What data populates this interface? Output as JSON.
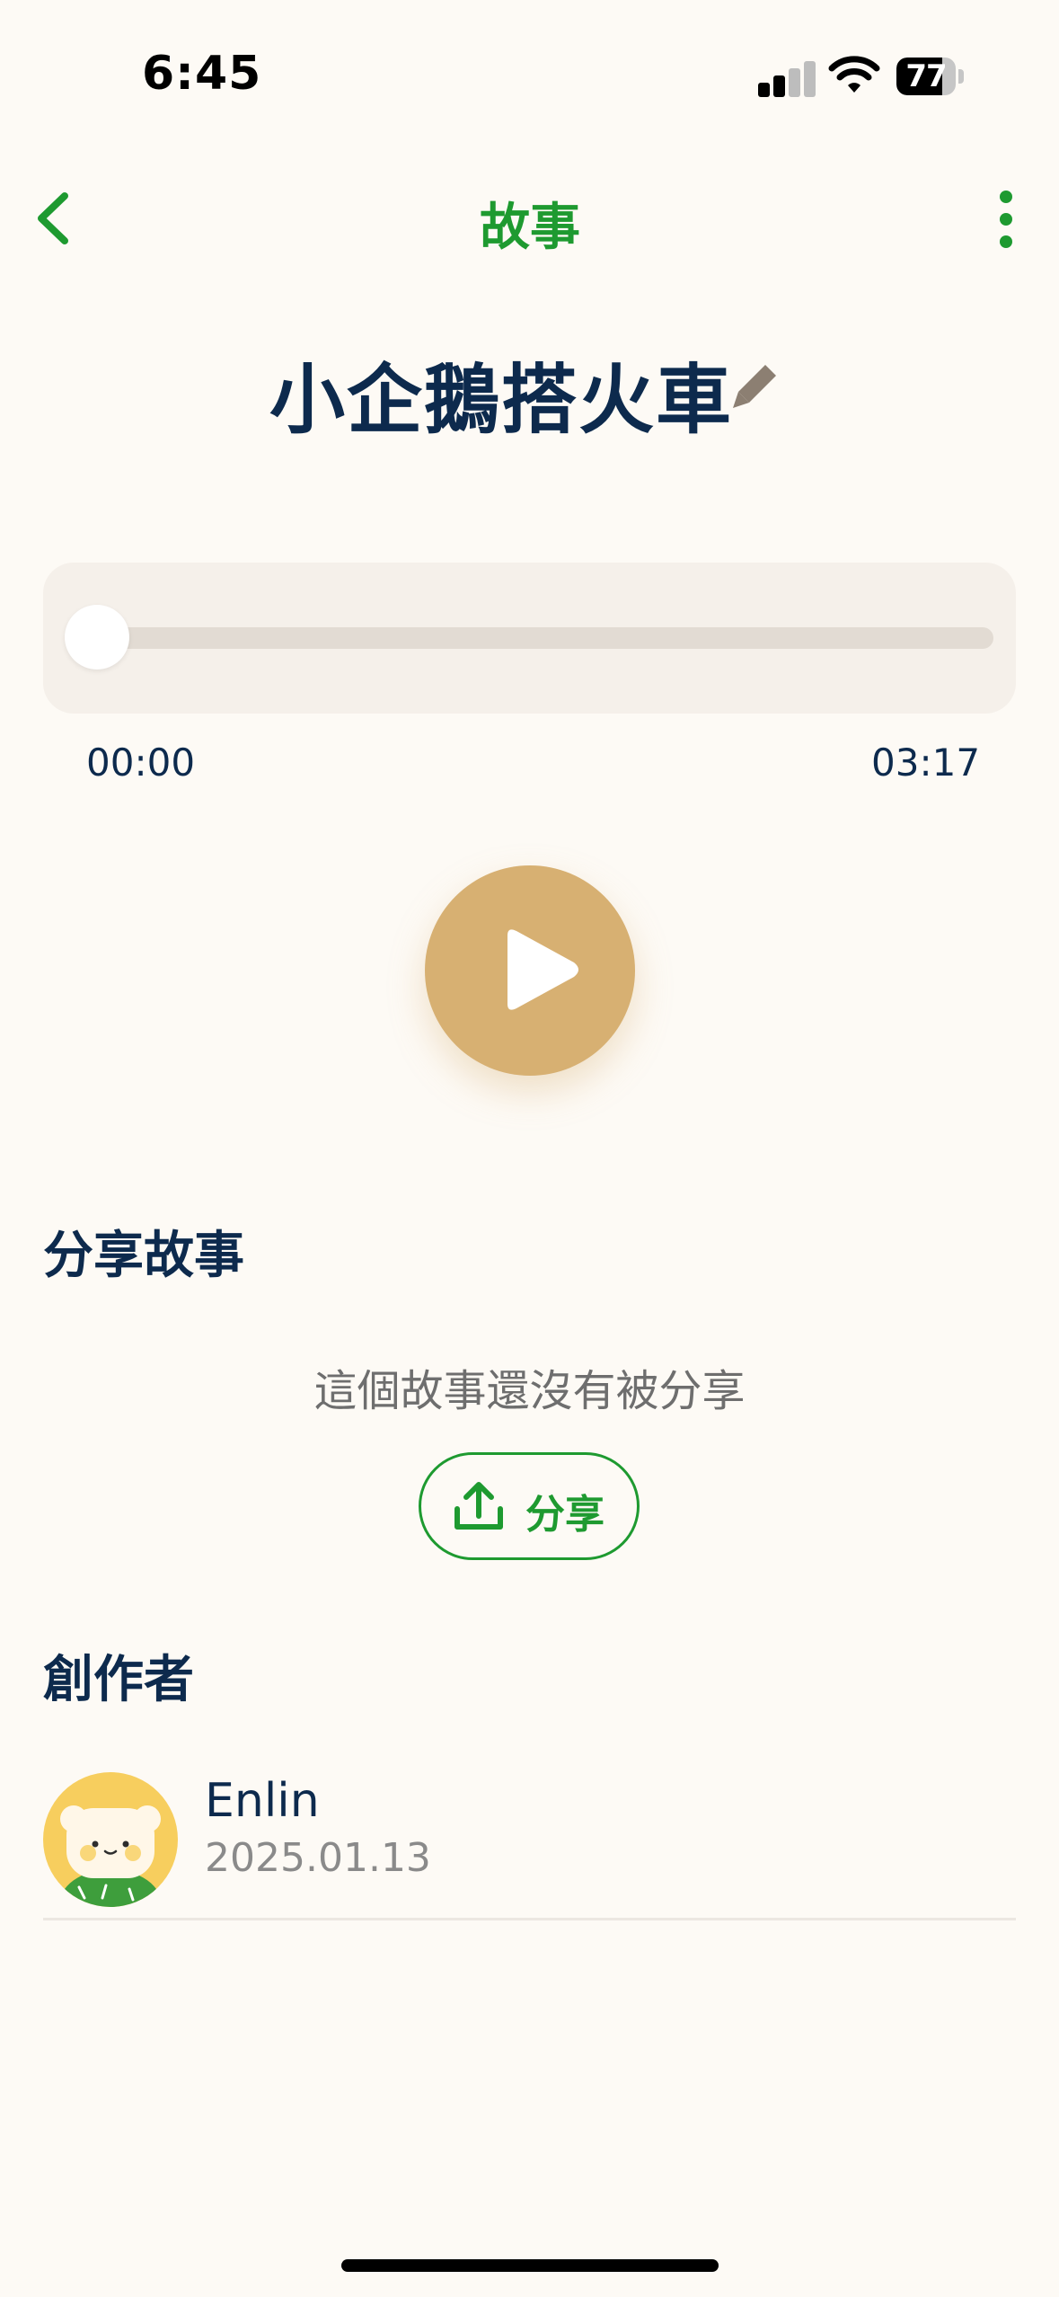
{
  "status_bar": {
    "time": "6:45",
    "battery": "77",
    "battery_level": 0.77
  },
  "nav": {
    "title": "故事",
    "back_icon": "chevron-left-icon",
    "more_icon": "more-vertical-icon"
  },
  "story": {
    "title": "小企鵝搭火車",
    "edit_icon": "pencil-icon"
  },
  "player": {
    "current_time": "00:00",
    "total_time": "03:17",
    "progress": 0,
    "play_icon": "play-icon"
  },
  "share": {
    "heading": "分享故事",
    "status": "這個故事還沒有被分享",
    "button_label": "分享",
    "button_icon": "upload-icon"
  },
  "creator": {
    "heading": "創作者",
    "name": "Enlin",
    "date": "2025.01.13"
  },
  "colors": {
    "background": "#FDFAF5",
    "accent_green": "#1E9A30",
    "navy": "#0D2A4D",
    "play_gold": "#D7B072",
    "avatar_yellow": "#F7CE5E"
  }
}
